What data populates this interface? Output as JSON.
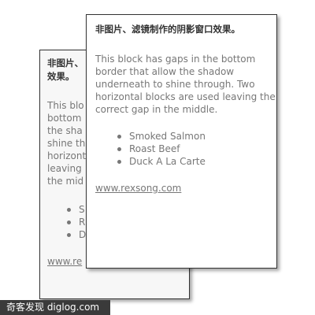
{
  "back_card": {
    "heading": "丰图片、滤镜制作的阴影窗口效果。",
    "paragraph": "This block has gaps in the bottom border that allow the shadow underneath to shine through. Two horizontal blocks are used leaving the correct gap in the middle.",
    "items": [
      "Smoked Salmon",
      "Roast Beef",
      "Duck A La Carte"
    ],
    "link": "www.rexsong.com"
  },
  "front_card": {
    "heading": "非图片、滤镜制作的阴影窗口效果。",
    "paragraph": "This block has gaps in the bottom border that allow the shadow underneath to shine through. Two horizontal blocks are used leaving the correct gap in the middle.",
    "items": [
      "Smoked Salmon",
      "Roast Beef",
      "Duck A La Carte"
    ],
    "link": "www.rexsong.com"
  },
  "watermark": "奇客发现 diglog.com"
}
